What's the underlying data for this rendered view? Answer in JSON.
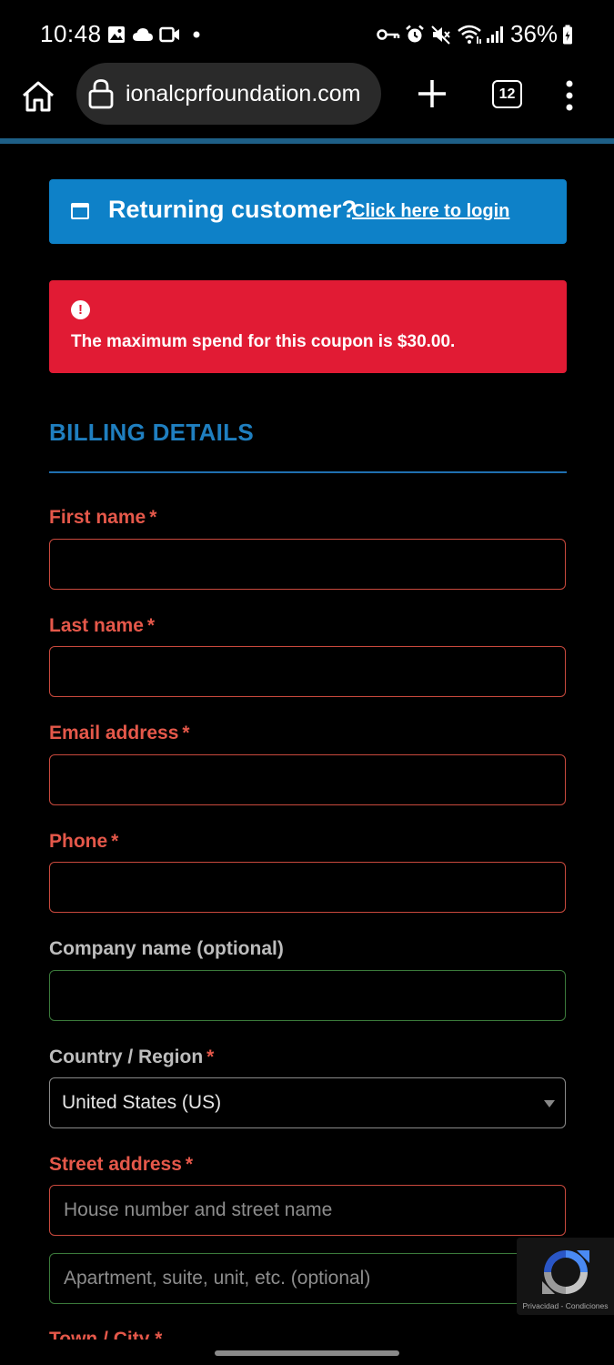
{
  "status_bar": {
    "time": "10:48",
    "battery": "36%",
    "icons": [
      "gallery-icon",
      "cloud-icon",
      "video-icon",
      "dot-icon",
      "key-icon",
      "alarm-icon",
      "mute-icon",
      "wifi-icon",
      "signal-icon",
      "battery-icon"
    ]
  },
  "browser": {
    "url": "ionalcprfoundation.com",
    "tab_count": "12"
  },
  "notices": {
    "returning_title": "Returning customer?",
    "returning_link": "Click here to login",
    "error_message": "The maximum spend for this coupon is $30.00."
  },
  "billing": {
    "heading": "BILLING DETAILS",
    "first_name_label": "First name",
    "last_name_label": "Last name",
    "email_label": "Email address",
    "phone_label": "Phone",
    "company_label": "Company name (optional)",
    "country_label": "Country / Region",
    "country_value": "United States (US)",
    "street_label": "Street address",
    "street_placeholder": "House number and street name",
    "apartment_placeholder": "Apartment, suite, unit, etc. (optional)",
    "town_label": "Town / City",
    "required_mark": "*"
  },
  "recaptcha": {
    "terms": "Privacidad - Condiciones"
  },
  "colors": {
    "info_blue": "#0e81c8",
    "error_red": "#e11b34",
    "heading_blue": "#1f7fc0",
    "required_label": "#e5584a"
  }
}
